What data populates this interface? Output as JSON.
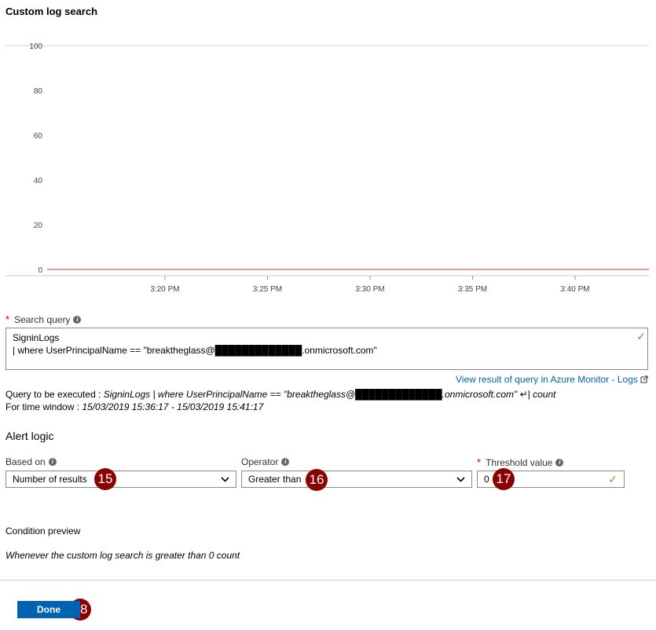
{
  "title": "Custom log search",
  "chart_data": {
    "type": "line",
    "ylim": [
      0,
      100
    ],
    "y_ticks": [
      "100",
      "80",
      "60",
      "40",
      "20",
      "0"
    ],
    "x_ticks": [
      "3:20 PM",
      "3:25 PM",
      "3:30 PM",
      "3:35 PM",
      "3:40 PM"
    ],
    "series": [
      {
        "values": [
          0,
          0,
          0,
          0,
          0
        ],
        "color": "#c04040"
      }
    ]
  },
  "search_query": {
    "required_mark": "*",
    "label": "Search query",
    "line1": "SigninLogs",
    "line2": "| where UserPrincipalName == \"breaktheglass@█████████████.onmicrosoft.com\""
  },
  "view_link": "View result of query in Azure Monitor - Logs",
  "query_exec": {
    "label": "Query to be executed :",
    "value": "SigninLogs | where UserPrincipalName == \"breaktheglass@█████████████.onmicrosoft.com\" ↵| count"
  },
  "time_window": {
    "label": "For time window :",
    "value": "15/03/2019 15:36:17 - 15/03/2019 15:41:17"
  },
  "alert_logic": {
    "heading": "Alert logic",
    "based_on_label": "Based on",
    "based_on_value": "Number of results",
    "operator_label": "Operator",
    "operator_value": "Greater than",
    "threshold_required": "*",
    "threshold_label": "Threshold value",
    "threshold_value": "0"
  },
  "condition_preview": {
    "label": "Condition preview",
    "text": "Whenever the custom log search is greater than 0 count"
  },
  "badges": {
    "b15": "15",
    "b16": "16",
    "b17": "17",
    "b18": "18"
  },
  "done_label": "Done",
  "colors": {
    "accent": "#0063b1",
    "badge": "#8b0000",
    "check": "#5ca30e"
  }
}
